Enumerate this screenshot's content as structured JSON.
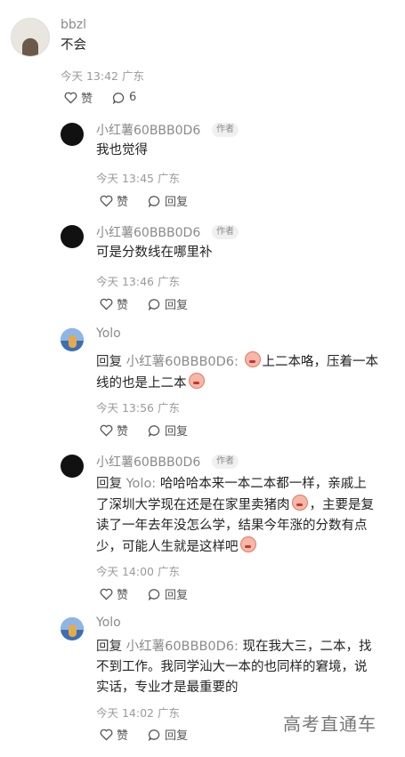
{
  "comments": [
    {
      "username": "bbzl",
      "text": "不会",
      "meta": "今天 13:42 广东",
      "like_label": "赞",
      "reply_count": "6"
    },
    {
      "username": "小红薯60BBB0D6",
      "badge": "作者",
      "text": "我也觉得",
      "meta": "今天 13:45 广东",
      "like_label": "赞",
      "reply_label": "回复"
    },
    {
      "username": "小红薯60BBB0D6",
      "badge": "作者",
      "text": "可是分数线在哪里补",
      "meta": "今天 13:46 广东",
      "like_label": "赞",
      "reply_label": "回复"
    },
    {
      "username": "Yolo",
      "reply_prefix": "回复",
      "reply_target": "小红薯60BBB0D6:",
      "text_line1": "上二本咯，压着一本",
      "text_line2": "线的也是上二本",
      "meta": "今天 13:56 广东",
      "like_label": "赞",
      "reply_label": "回复"
    },
    {
      "username": "小红薯60BBB0D6",
      "badge": "作者",
      "reply_prefix": "回复",
      "reply_target": "Yolo:",
      "text_line1": "哈哈哈本来一本二本都一样，亲戚上",
      "text_line2": "了深圳大学现在还是在家里卖猪肉",
      "text_line2b": "，主要是复",
      "text_line3": "读了一年去年没怎么学，结果今年涨的分数有点",
      "text_line4": "少，可能人生就是这样吧",
      "meta": "今天 14:00 广东",
      "like_label": "赞",
      "reply_label": "回复"
    },
    {
      "username": "Yolo",
      "reply_prefix": "回复",
      "reply_target": "小红薯60BBB0D6:",
      "text_line1": "现在我大三，二本，找",
      "text_line2": "不到工作。我同学汕大一本的也同样的窘境，说",
      "text_line3": "实话，专业才是最重要的",
      "meta": "今天 14:02 广东",
      "like_label": "赞",
      "reply_label": "回复"
    }
  ],
  "watermark": "高考直通车",
  "icons": {
    "like": "heart-icon",
    "comment": "speech-bubble-icon"
  }
}
